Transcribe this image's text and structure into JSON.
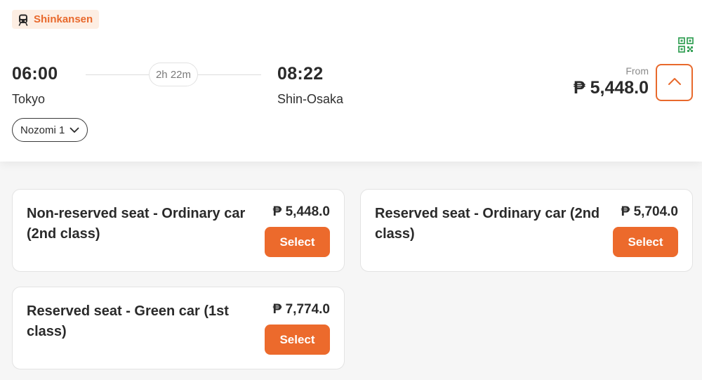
{
  "badge": {
    "label": "Shinkansen",
    "icon": "train-icon"
  },
  "trip": {
    "depart_time": "06:00",
    "depart_city": "Tokyo",
    "arrive_time": "08:22",
    "arrive_city": "Shin-Osaka",
    "duration": "2h 22m",
    "train_name": "Nozomi 1"
  },
  "pricing": {
    "from_label": "From",
    "price": "₱ 5,448.0"
  },
  "colors": {
    "accent": "#ec6a2c",
    "badge_bg": "#fdeee3",
    "qr": "#3aa35b"
  },
  "seats": [
    {
      "name": "Non-reserved seat - Ordinary car (2nd class)",
      "price": "₱ 5,448.0",
      "button": "Select"
    },
    {
      "name": "Reserved seat - Ordinary car (2nd class)",
      "price": "₱ 5,704.0",
      "button": "Select"
    },
    {
      "name": "Reserved seat - Green car (1st class)",
      "price": "₱ 7,774.0",
      "button": "Select"
    }
  ]
}
